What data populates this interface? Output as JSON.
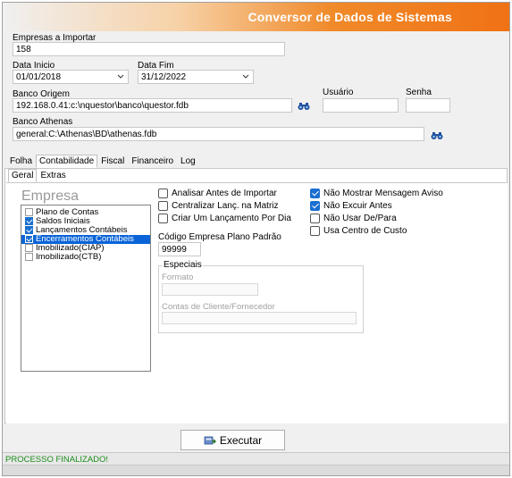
{
  "header": {
    "title": "Conversor de Dados de Sistemas",
    "bg_color": "#f07214"
  },
  "form": {
    "empresas_label": "Empresas a Importar",
    "empresas_value": "158",
    "data_inicio_label": "Data Inicio",
    "data_inicio_value": "01/01/2018",
    "data_fim_label": "Data Fim",
    "data_fim_value": "31/12/2022",
    "banco_origem_label": "Banco Origem",
    "banco_origem_value": "192.168.0.41:c:\\nquestor\\banco\\questor.fdb",
    "usuario_label": "Usuário",
    "usuario_value": "",
    "senha_label": "Senha",
    "senha_value": "",
    "banco_athenas_label": "Banco Athenas",
    "banco_athenas_value": "general:C:\\Athenas\\BD\\athenas.fdb"
  },
  "tabs": [
    "Folha",
    "Contabilidade",
    "Fiscal",
    "Financeiro",
    "Log"
  ],
  "active_tab": "Contabilidade",
  "subtabs": [
    "Geral",
    "Extras"
  ],
  "active_subtab": "Geral",
  "empresa": {
    "title": "Empresa",
    "items": [
      {
        "label": "Plano de Contas",
        "checked": false,
        "selected": false
      },
      {
        "label": "Saldos Iniciais",
        "checked": true,
        "selected": false
      },
      {
        "label": "Lançamentos Contábeis",
        "checked": true,
        "selected": false
      },
      {
        "label": "Encerramentos Contábeis",
        "checked": true,
        "selected": true
      },
      {
        "label": "Imobilizado(CIAP)",
        "checked": false,
        "selected": false
      },
      {
        "label": "Imobilizado(CTB)",
        "checked": false,
        "selected": false
      }
    ]
  },
  "options_mid": [
    {
      "label": "Analisar Antes de Importar",
      "checked": false
    },
    {
      "label": "Centralizar Lanç. na Matriz",
      "checked": false
    },
    {
      "label": "Criar Um Lançamento Por Dia",
      "checked": false
    }
  ],
  "options_right": [
    {
      "label": "Não Mostrar Mensagem Aviso",
      "checked": true
    },
    {
      "label": "Não Excuir Antes",
      "checked": true
    },
    {
      "label": "Não Usar De/Para",
      "checked": false
    },
    {
      "label": "Usa Centro de Custo",
      "checked": false
    }
  ],
  "codigo": {
    "label": "Código Empresa Plano Padrão",
    "value": "99999"
  },
  "especiais": {
    "title": "Especiais",
    "formato_label": "Formato",
    "formato_value": "",
    "contas_label": "Contas de Cliente/Fornecedor",
    "contas_value": ""
  },
  "executar_label": "Executar",
  "status_text": "PROCESSO FINALIZADO!"
}
